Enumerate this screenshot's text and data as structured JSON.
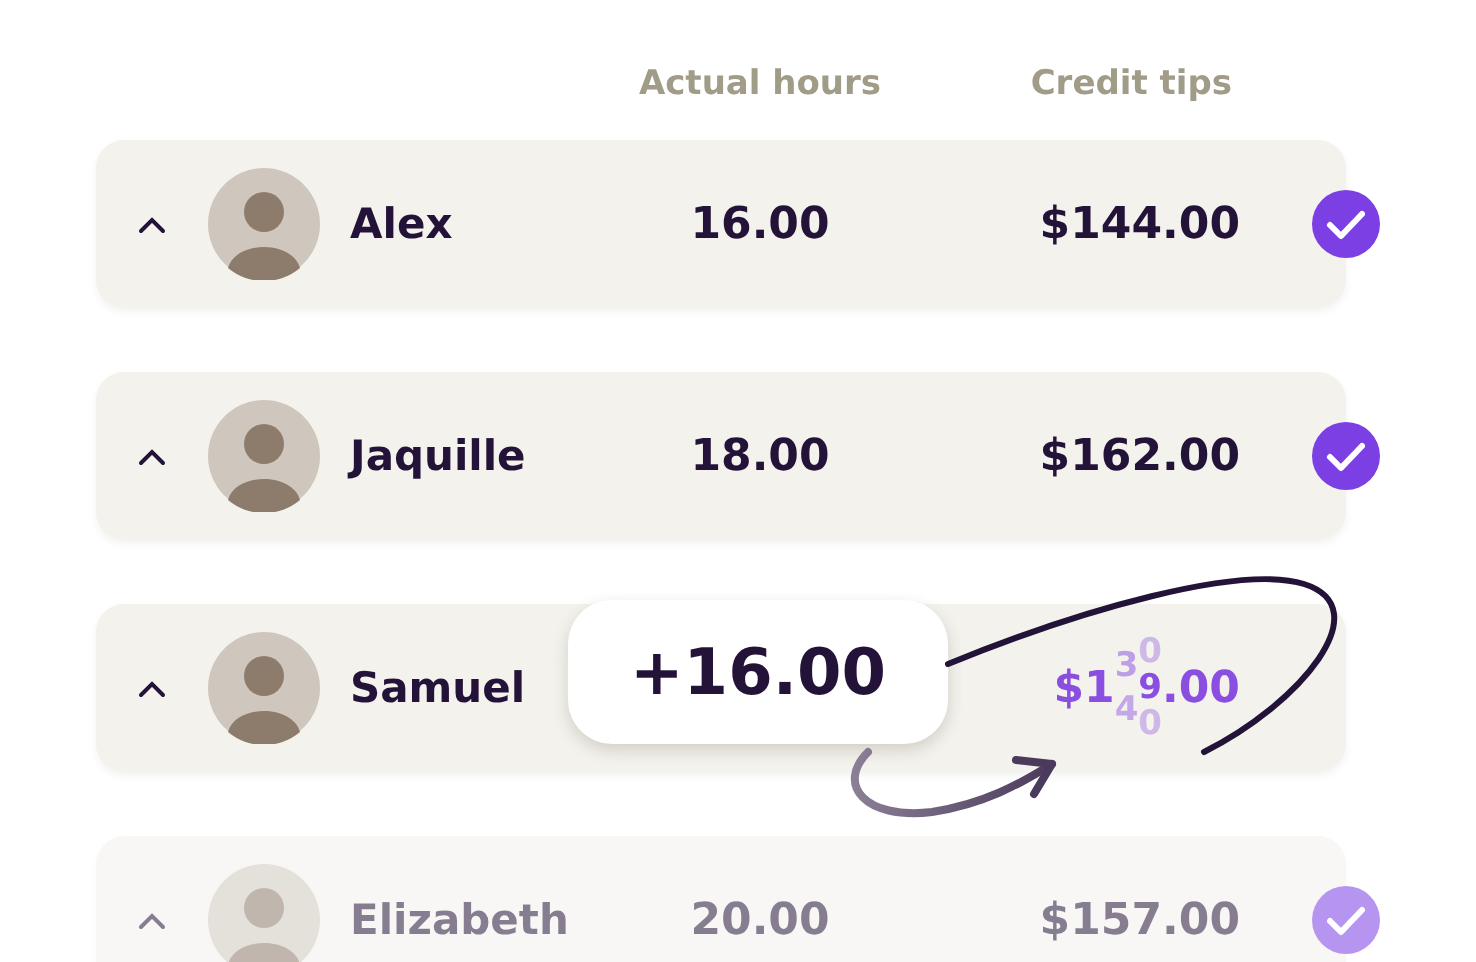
{
  "columns": [
    "Actual hours",
    "Credit tips"
  ],
  "rows": [
    {
      "kind": "normal",
      "name": "Alex",
      "hours": "16.00",
      "tips": "$144.00",
      "checked": true,
      "expanded": true
    },
    {
      "kind": "normal",
      "name": "Jaquille",
      "hours": "18.00",
      "tips": "$162.00",
      "checked": true,
      "expanded": true
    },
    {
      "kind": "animating",
      "name": "Samuel",
      "tip_prefix": "$1",
      "digit_columns": [
        [
          "3",
          "4"
        ],
        [
          "0",
          "9",
          "0"
        ]
      ],
      "tip_suffix": ".00",
      "popup": "+16.00",
      "checked": false,
      "expanded": true
    },
    {
      "kind": "faded",
      "name": "Elizabeth",
      "hours": "20.00",
      "tips": "$157.00",
      "checked": true,
      "expanded": true
    }
  ]
}
